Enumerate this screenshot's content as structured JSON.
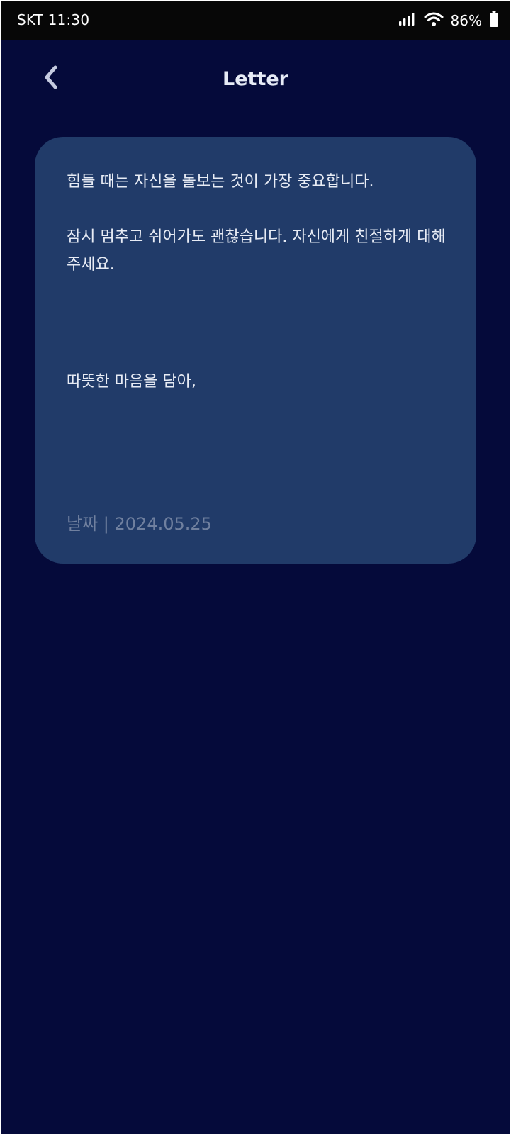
{
  "status_bar": {
    "carrier_time": "SKT 11:30",
    "battery_percent": "86%",
    "signal_icon": "cellular-signal-icon",
    "wifi_icon": "wifi-icon",
    "battery_icon": "battery-icon"
  },
  "header": {
    "back_icon": "chevron-left-icon",
    "title": "Letter"
  },
  "letter": {
    "paragraph_1": "힘들 때는 자신을 돌보는 것이 가장 중요합니다.",
    "paragraph_2": "잠시 멈추고 쉬어가도 괜찮습니다. 자신에게 친절하게 대해주세요.",
    "closing": "따뜻한 마음을 담아,",
    "date_line": "날짜 | 2024.05.25"
  },
  "colors": {
    "background": "#050a3a",
    "status_bar": "#070707",
    "card": "#213b69",
    "text": "#e8ecf5",
    "muted_text": "#70809f"
  }
}
